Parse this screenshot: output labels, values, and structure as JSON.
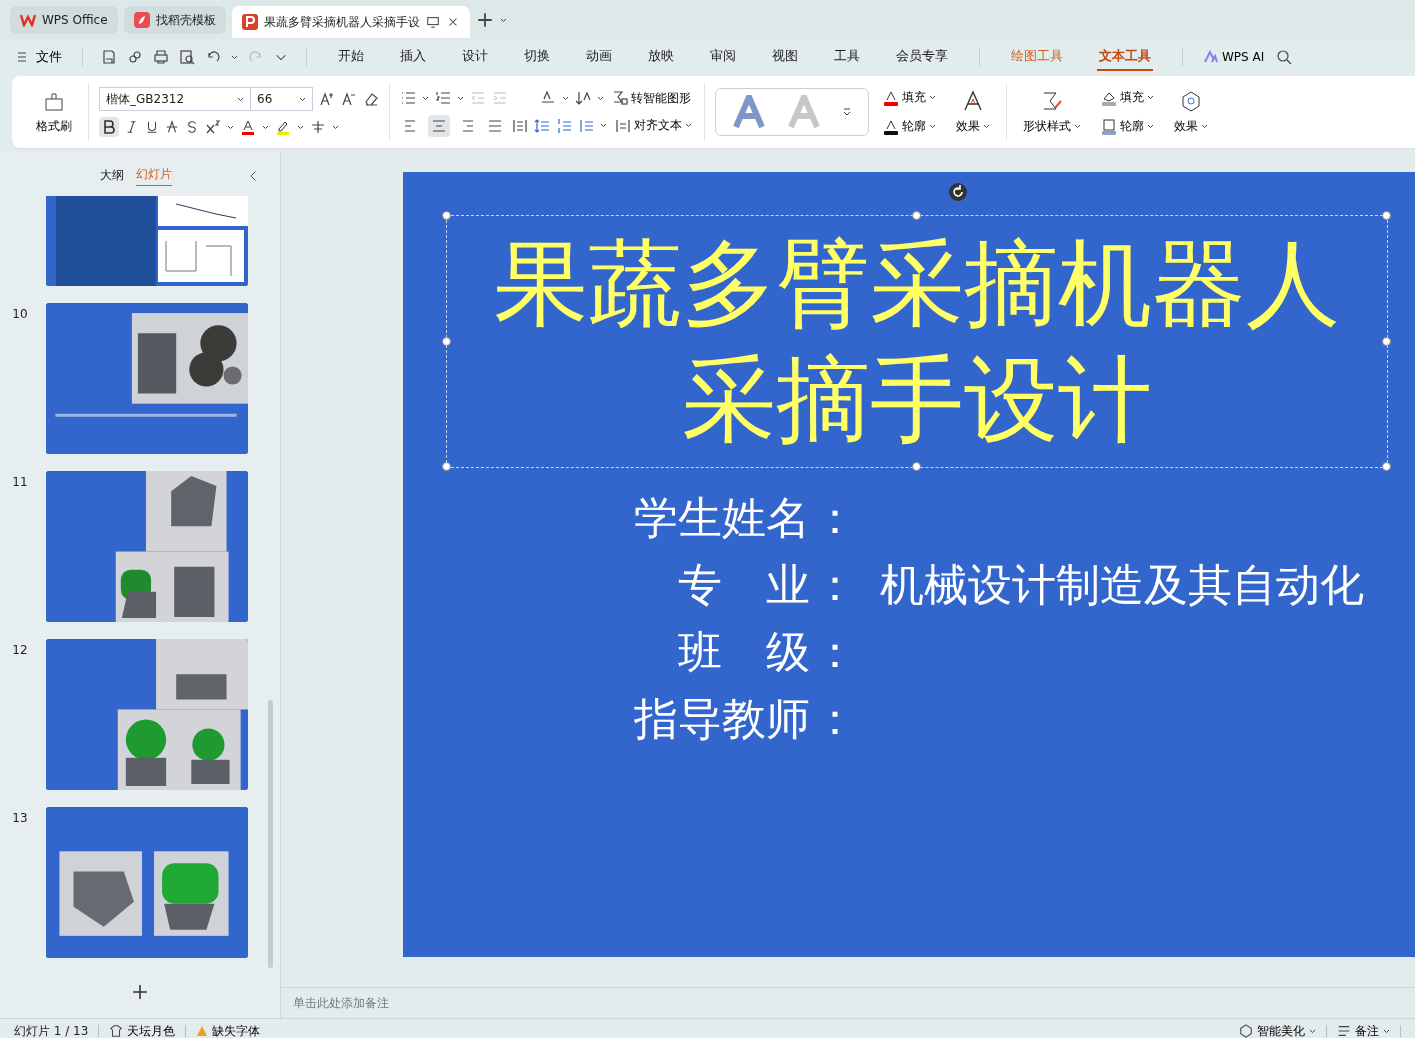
{
  "tabs": [
    {
      "label": "WPS Office",
      "kind": "home",
      "selected": false
    },
    {
      "label": "找稻壳模板",
      "kind": "template",
      "selected": false
    },
    {
      "label": "果蔬多臂采摘机器人采摘手设",
      "kind": "doc",
      "selected": true
    }
  ],
  "menu": {
    "file": "文件",
    "tabs": [
      {
        "label": "开始",
        "selected": false
      },
      {
        "label": "插入",
        "selected": false
      },
      {
        "label": "设计",
        "selected": false
      },
      {
        "label": "切换",
        "selected": false
      },
      {
        "label": "动画",
        "selected": false
      },
      {
        "label": "放映",
        "selected": false
      },
      {
        "label": "审阅",
        "selected": false
      },
      {
        "label": "视图",
        "selected": false
      },
      {
        "label": "工具",
        "selected": false
      },
      {
        "label": "会员专享",
        "selected": false
      }
    ],
    "context_tabs": [
      {
        "label": "绘图工具",
        "selected": false
      },
      {
        "label": "文本工具",
        "selected": true
      }
    ],
    "ai": "WPS AI"
  },
  "ribbon": {
    "format_painter": "格式刷",
    "font": "楷体_GB2312",
    "size": "66",
    "bold": true,
    "align_buttons": [
      {
        "kind": "left",
        "selected": false
      },
      {
        "kind": "center",
        "selected": true
      },
      {
        "kind": "right",
        "selected": false
      },
      {
        "kind": "justify",
        "selected": false
      }
    ],
    "smart_art": "转智能图形",
    "align_text": "对齐文本",
    "text_fill": "填充",
    "text_outline": "轮廓",
    "text_effects": "效果",
    "shape_style": "形状样式",
    "shape_fill": "填充",
    "shape_outline": "轮廓",
    "shape_effects": "效果"
  },
  "panel": {
    "tabs": [
      {
        "label": "大纲",
        "selected": false
      },
      {
        "label": "幻灯片",
        "selected": true
      }
    ],
    "thumbnails": [
      {
        "kind": "picture"
      },
      {
        "number": "10",
        "kind": "picture"
      },
      {
        "number": "11",
        "kind": "picture"
      },
      {
        "number": "12",
        "kind": "picture"
      },
      {
        "number": "13",
        "kind": "picture"
      }
    ]
  },
  "slide": {
    "title_lines": [
      "果蔬多臂采摘机器人",
      "采摘手设计"
    ],
    "fields": [
      {
        "label": "学生姓名",
        "separator": "："
      },
      {
        "label": "专　业",
        "separator": "：",
        "value": "机械设计制造及其自动化"
      },
      {
        "label": "班　级",
        "separator": "："
      },
      {
        "label": "指导教师",
        "separator": "："
      }
    ]
  },
  "notes": {
    "placeholder": "单击此处添加备注"
  },
  "status_bar": {
    "slide": "幻灯片 1 / 13",
    "theme": "天坛月色",
    "missing_fonts": "缺失字体",
    "beautify": "智能美化",
    "notes": "备注"
  }
}
